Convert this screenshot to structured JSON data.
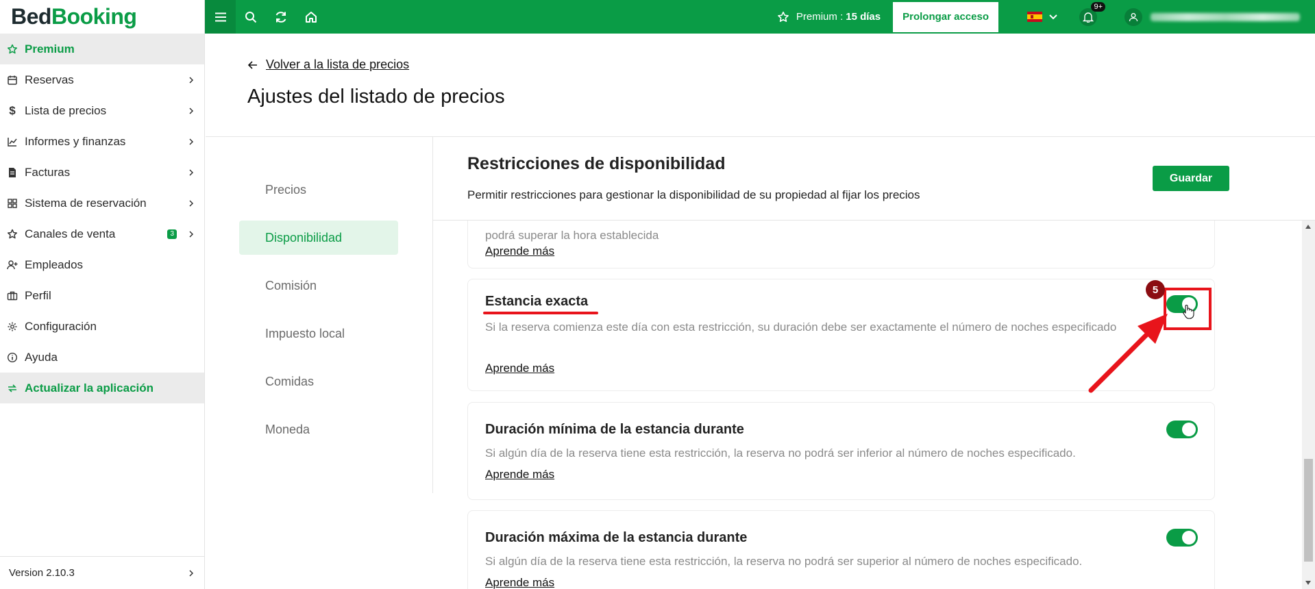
{
  "app": {
    "logo_part1": "Bed",
    "logo_part2": "Booking",
    "version": "Version 2.10.3"
  },
  "sidebar": {
    "items": [
      {
        "label": "Premium",
        "icon": "star-icon"
      },
      {
        "label": "Reservas",
        "icon": "calendar-icon"
      },
      {
        "label": "Lista de precios",
        "icon": "dollar-icon"
      },
      {
        "label": "Informes y finanzas",
        "icon": "chart-icon"
      },
      {
        "label": "Facturas",
        "icon": "invoice-icon"
      },
      {
        "label": "Sistema de reservación",
        "icon": "grid-icon"
      },
      {
        "label": "Canales de venta",
        "icon": "star-icon",
        "badge": "3"
      },
      {
        "label": "Empleados",
        "icon": "user-add-icon"
      },
      {
        "label": "Perfil",
        "icon": "briefcase-icon"
      },
      {
        "label": "Configuración",
        "icon": "gear-icon"
      },
      {
        "label": "Ayuda",
        "icon": "info-icon"
      },
      {
        "label": "Actualizar la aplicación",
        "icon": "refresh-icon"
      }
    ]
  },
  "topbar": {
    "premium_label": "Premium :",
    "premium_days": "15 días",
    "prolong_label": "Prolongar acceso",
    "notifications": "9+"
  },
  "header": {
    "back_label": "Volver a la lista de precios",
    "title": "Ajustes del listado de precios"
  },
  "tabs": [
    {
      "label": "Precios"
    },
    {
      "label": "Disponibilidad"
    },
    {
      "label": "Comisión"
    },
    {
      "label": "Impuesto local"
    },
    {
      "label": "Comidas"
    },
    {
      "label": "Moneda"
    }
  ],
  "section": {
    "title": "Restricciones de disponibilidad",
    "description": "Permitir restricciones para gestionar la disponibilidad de su propiedad al fijar los precios",
    "save_label": "Guardar"
  },
  "cards": [
    {
      "partial_text": "podrá superar la hora establecida",
      "link": "Aprende más"
    },
    {
      "title": "Estancia exacta",
      "description": "Si la reserva comienza este día con esta restricción, su duración debe ser exactamente el número de noches especificado",
      "link": "Aprende más",
      "enabled": true
    },
    {
      "title": "Duración mínima de la estancia durante",
      "description": "Si algún día de la reserva tiene esta restricción, la reserva no podrá ser inferior al número de noches especificado.",
      "link": "Aprende más",
      "enabled": true
    },
    {
      "title": "Duración máxima de la estancia durante",
      "description": "Si algún día de la reserva tiene esta restricción, la reserva no podrá ser superior al número de noches especificado.",
      "link": "Aprende más",
      "enabled": true
    }
  ],
  "annotation": {
    "step": "5",
    "color": "#e8141b"
  },
  "colors": {
    "brand": "#0a9c46",
    "active_tab_bg": "#e3f5e9"
  }
}
